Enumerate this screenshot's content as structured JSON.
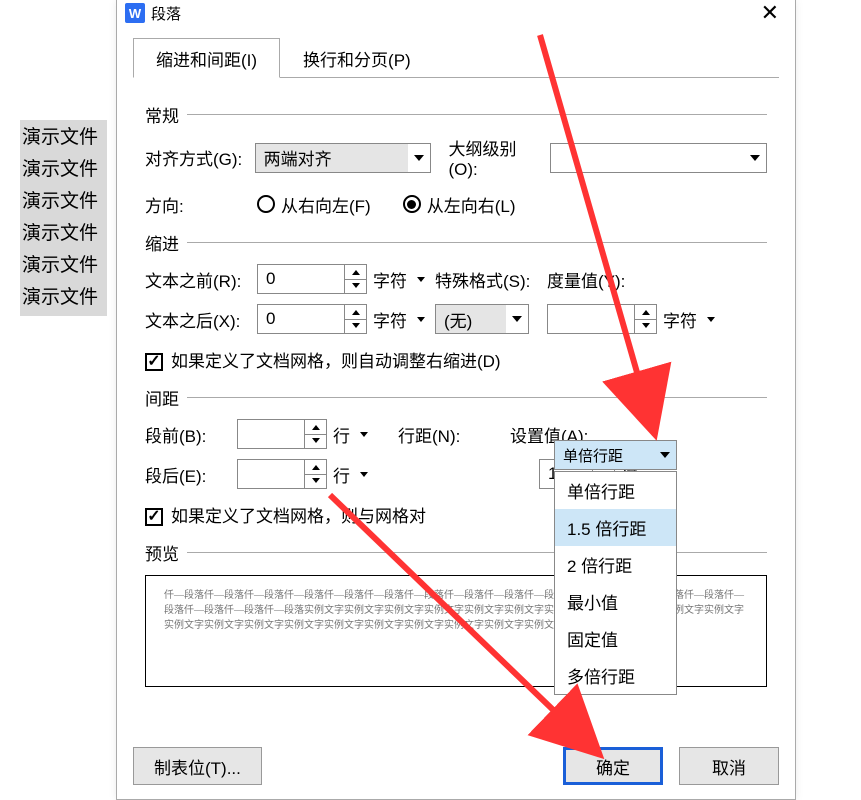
{
  "bgList": [
    "演示文件",
    "演示文件",
    "演示文件",
    "演示文件",
    "演示文件",
    "演示文件"
  ],
  "dialog": {
    "appIcon": "W",
    "title": "段落",
    "close": "✕"
  },
  "tabs": {
    "t1": "缩进和间距(I)",
    "t2": "换行和分页(P)"
  },
  "group": {
    "general": "常规",
    "indent": "缩进",
    "spacing": "间距",
    "preview": "预览"
  },
  "general": {
    "alignLabel": "对齐方式(G):",
    "alignValue": "两端对齐",
    "outlineLabel": "大纲级别(O):",
    "outlineValue": "",
    "dirLabel": "方向:",
    "dirRtoL": "从右向左(F)",
    "dirLtoR": "从左向右(L)"
  },
  "indent": {
    "beforeLabel": "文本之前(R):",
    "beforeVal": "0",
    "afterLabel": "文本之后(X):",
    "afterVal": "0",
    "unitChar": "字符",
    "specialLabel": "特殊格式(S):",
    "specialVal": "(无)",
    "measureLabel": "度量值(Y):",
    "measureVal": "",
    "checkGrid": "如果定义了文档网格，则自动调整右缩进(D)"
  },
  "spacing": {
    "beforeLabel": "段前(B):",
    "afterLabel": "段后(E):",
    "lineUnit": "行",
    "lineLabel": "行距(N):",
    "lineVal": "单倍行距",
    "setLabel": "设置值(A):",
    "setVal": "1",
    "setUnit": "倍",
    "checkGrid": "如果定义了文档网格，则与网格对"
  },
  "dropdown": {
    "o1": "单倍行距",
    "o2": "1.5 倍行距",
    "o3": "2 倍行距",
    "o4": "最小值",
    "o5": "固定值",
    "o6": "多倍行距"
  },
  "previewText": "仟—段落仟—段落仟—段落仟—段落仟—段落仟—段落仟—段落仟—段落仟—段落仟—段落仟—段落仟—段落仟—段落仟—段落仟—段落仟—段落仟—段落仟—段落实例文字实例文字实例文字实例文字实例文字实例文字实例文字实例文字实例文字实例文字实例文字实例文字实例文字实例文字实例文字实例文字实例文字实例文字实例文字实例文字实例文字实例文字",
  "buttons": {
    "tab": "制表位(T)...",
    "ok": "确定",
    "cancel": "取消"
  }
}
